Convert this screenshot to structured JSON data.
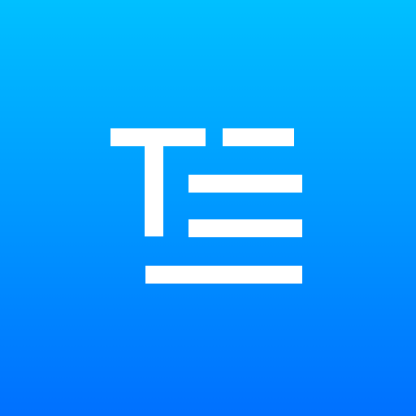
{
  "icon": {
    "name": "text-editor-app-icon",
    "glyph": "text-lines-icon",
    "colors": {
      "gradient_top": "#00C0FF",
      "gradient_bottom": "#0070FF",
      "glyph": "#FFFFFF"
    }
  }
}
